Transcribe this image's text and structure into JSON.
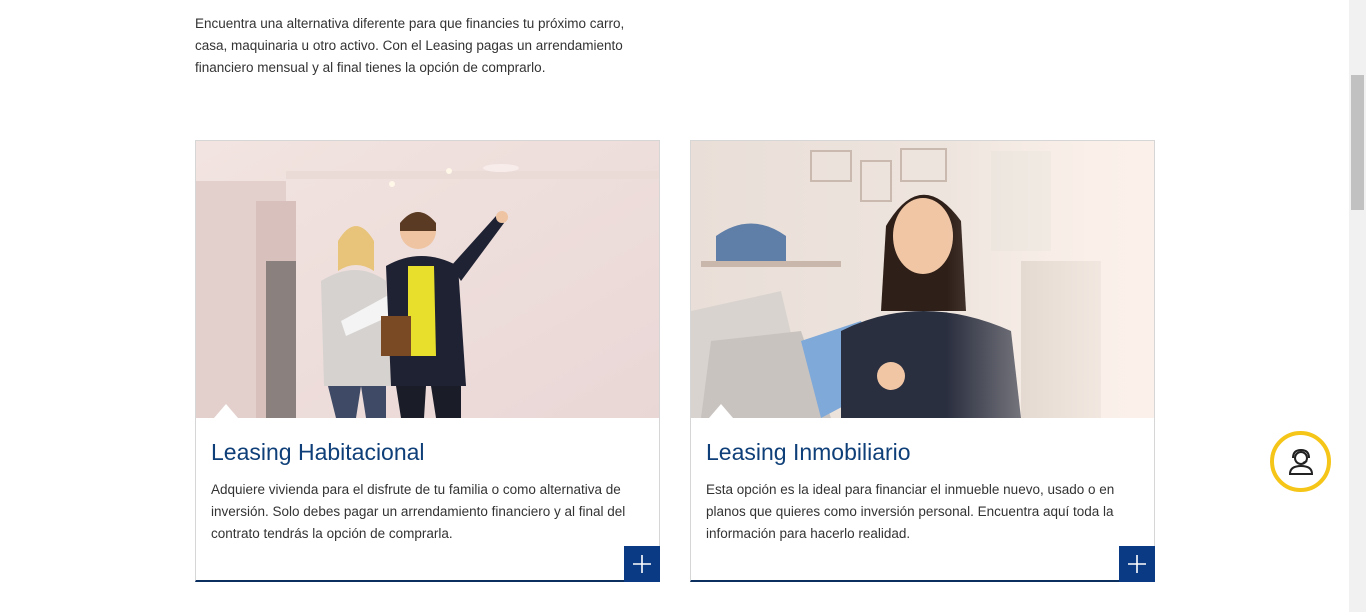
{
  "intro": {
    "text": "Encuentra una alternativa diferente para que financies tu próximo carro, casa, maquinaria u otro activo. Con el Leasing pagas un arrendamiento financiero mensual y al final tienes la opción de comprarlo."
  },
  "cards": [
    {
      "title": "Leasing Habitacional",
      "description": "Adquiere vivienda para el disfrute de tu familia o como alternativa de inversión. Solo debes pagar un arrendamiento financiero y al final del contrato tendrás la opción de comprarla.",
      "image_icon": "couple-house-photo"
    },
    {
      "title": "Leasing Inmobiliario",
      "description": "Esta opción es la ideal para financiar el inmueble nuevo, usado o en planos que quieres como inversión personal. Encuentra aquí toda la información para hacerlo realidad.",
      "image_icon": "shop-owner-photo"
    }
  ],
  "colors": {
    "title_blue": "#0f3f78",
    "button_blue": "#0a3a84",
    "help_ring": "#f5c518"
  },
  "icons": {
    "plus": "plus-icon",
    "help": "help-agent-icon"
  }
}
